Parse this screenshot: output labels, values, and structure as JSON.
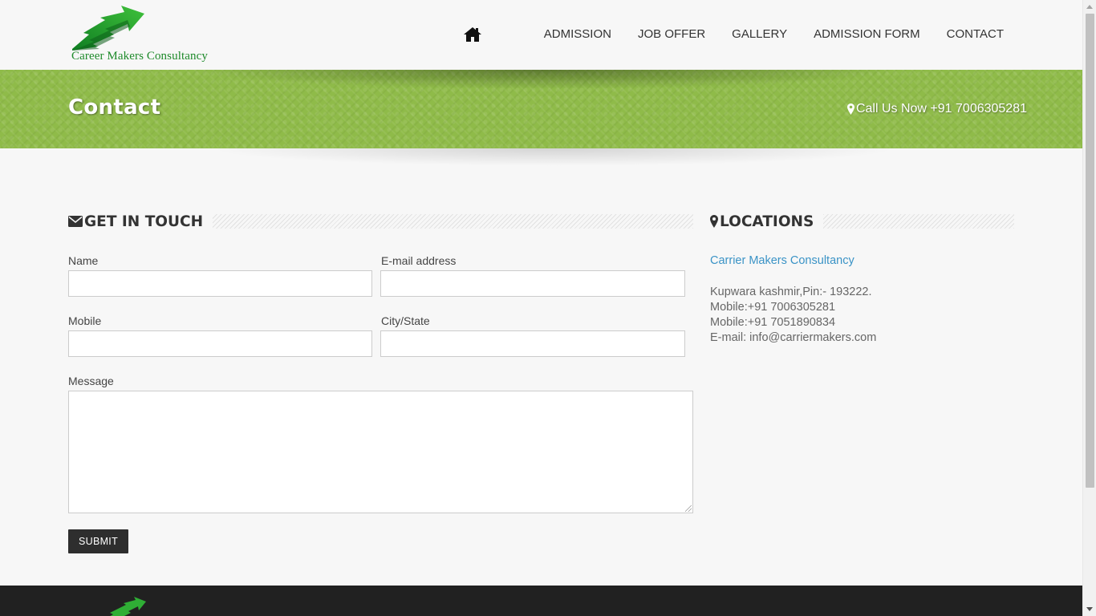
{
  "header": {
    "logo_text": "Career Makers Consultancy",
    "nav": {
      "home_icon": "home-icon",
      "items": [
        {
          "label": "ADMISSION"
        },
        {
          "label": "JOB OFFER"
        },
        {
          "label": "GALLERY"
        },
        {
          "label": "ADMISSION FORM"
        },
        {
          "label": "CONTACT"
        }
      ]
    }
  },
  "banner": {
    "title": "Contact",
    "call_text": "Call Us Now +91 7006305281",
    "call_icon": "map-marker-icon",
    "color": "#8fbb49"
  },
  "contact_form": {
    "heading": "GET IN TOUCH",
    "heading_icon": "envelope-icon",
    "fields": {
      "name": {
        "label": "Name",
        "value": ""
      },
      "email": {
        "label": "E-mail address",
        "value": ""
      },
      "mobile": {
        "label": "Mobile",
        "value": ""
      },
      "city": {
        "label": "City/State",
        "value": ""
      },
      "message": {
        "label": "Message",
        "value": ""
      }
    },
    "submit_label": "SUBMIT"
  },
  "locations": {
    "heading": "LOCATIONS",
    "heading_icon": "map-marker-icon",
    "name": "Carrier Makers Consultancy",
    "lines": [
      "Kupwara kashmir,Pin:- 193222.",
      "Mobile:+91 7006305281",
      "Mobile:+91 7051890834",
      "E-mail: info@carriermakers.com"
    ],
    "link_color": "#3a93c6"
  },
  "colors": {
    "footer": "#212121",
    "submit": "#2e2e2e"
  }
}
